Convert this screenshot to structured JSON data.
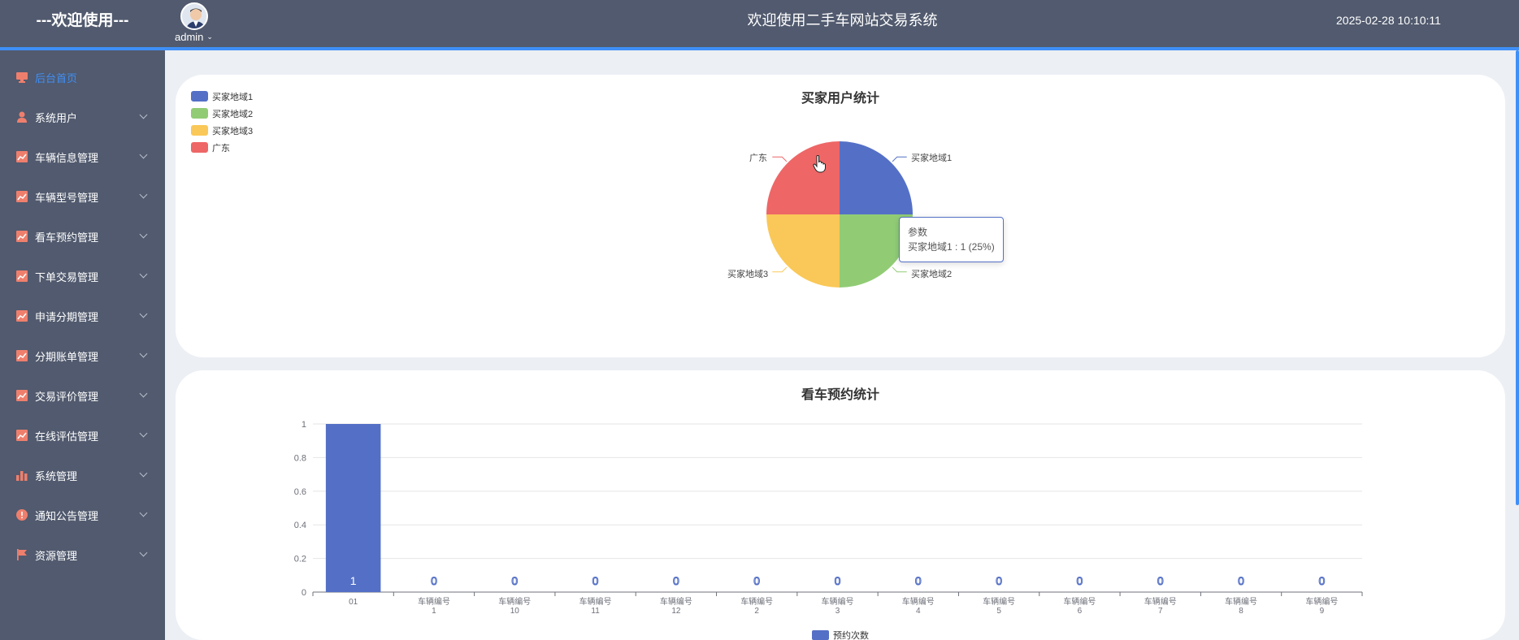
{
  "header": {
    "brand": "---欢迎使用---",
    "user": "admin",
    "title": "欢迎使用二手车网站交易系统",
    "datetime": "2025-02-28 10:10:11"
  },
  "sidebar": {
    "items": [
      {
        "label": "后台首页",
        "icon": "monitor-icon",
        "active": true
      },
      {
        "label": "系统用户",
        "icon": "user-icon"
      },
      {
        "label": "车辆信息管理",
        "icon": "chart-line-icon"
      },
      {
        "label": "车辆型号管理",
        "icon": "chart-line-icon"
      },
      {
        "label": "看车预约管理",
        "icon": "chart-line-icon"
      },
      {
        "label": "下单交易管理",
        "icon": "chart-line-icon"
      },
      {
        "label": "申请分期管理",
        "icon": "chart-line-icon"
      },
      {
        "label": "分期账单管理",
        "icon": "chart-line-icon"
      },
      {
        "label": "交易评价管理",
        "icon": "chart-line-icon"
      },
      {
        "label": "在线评估管理",
        "icon": "chart-line-icon"
      },
      {
        "label": "系统管理",
        "icon": "bar-chart-icon"
      },
      {
        "label": "通知公告管理",
        "icon": "info-icon"
      },
      {
        "label": "资源管理",
        "icon": "flag-icon"
      }
    ],
    "colors": {
      "icon": "#ef7f6d",
      "active": "#3f8ff7"
    }
  },
  "pie": {
    "title": "买家用户统计",
    "legend": [
      "买家地域1",
      "买家地域2",
      "买家地域3",
      "广东"
    ],
    "tooltip": {
      "series": "参数",
      "text": "买家地域1 : 1 (25%)"
    }
  },
  "bars": {
    "title": "看车预约统计",
    "legend": "预约次数"
  },
  "chart_data": [
    {
      "type": "pie",
      "title": "买家用户统计",
      "labels": [
        "买家地域1",
        "买家地域2",
        "买家地域3",
        "广东"
      ],
      "values": [
        1,
        1,
        1,
        1
      ],
      "colors": [
        "#5470c6",
        "#91cc75",
        "#fac858",
        "#ee6666"
      ],
      "legend": "top-left"
    },
    {
      "type": "bar",
      "title": "看车预约统计",
      "categories": [
        "01",
        "车辆编号\n1",
        "车辆编号\n10",
        "车辆编号\n11",
        "车辆编号\n12",
        "车辆编号\n2",
        "车辆编号\n3",
        "车辆编号\n4",
        "车辆编号\n5",
        "车辆编号\n6",
        "车辆编号\n7",
        "车辆编号\n8",
        "车辆编号\n9"
      ],
      "series": [
        {
          "name": "预约次数",
          "values": [
            1,
            0,
            0,
            0,
            0,
            0,
            0,
            0,
            0,
            0,
            0,
            0,
            0
          ]
        }
      ],
      "yticks": [
        "0",
        "0.2",
        "0.4",
        "0.6",
        "0.8",
        "1"
      ],
      "ylim": [
        0,
        1
      ],
      "grid": true,
      "color": "#5470c6",
      "legend": "bottom-center"
    }
  ]
}
